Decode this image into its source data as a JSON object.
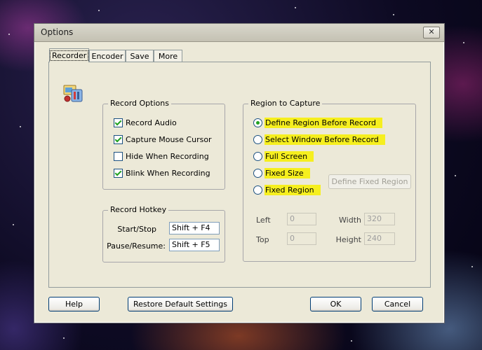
{
  "window": {
    "title": "Options",
    "close_glyph": "✕"
  },
  "tabs": [
    {
      "label": "Recorder",
      "active": true
    },
    {
      "label": "Encoder",
      "active": false
    },
    {
      "label": "Save",
      "active": false
    },
    {
      "label": "More",
      "active": false
    }
  ],
  "record_options": {
    "title": "Record Options",
    "items": [
      {
        "label": "Record Audio",
        "checked": true
      },
      {
        "label": "Capture Mouse Cursor",
        "checked": true
      },
      {
        "label": "Hide When Recording",
        "checked": false
      },
      {
        "label": "Blink When Recording",
        "checked": true
      }
    ]
  },
  "record_hotkey": {
    "title": "Record Hotkey",
    "start_stop_label": "Start/Stop",
    "start_stop_value": "Shift + F4",
    "pause_resume_label": "Pause/Resume:",
    "pause_resume_value": "Shift + F5"
  },
  "region": {
    "title": "Region to Capture",
    "options": [
      {
        "label": "Define Region Before Record",
        "selected": true
      },
      {
        "label": "Select Window Before Record",
        "selected": false
      },
      {
        "label": "Full Screen",
        "selected": false
      },
      {
        "label": "Fixed Size",
        "selected": false
      },
      {
        "label": "Fixed Region",
        "selected": false
      }
    ],
    "define_fixed_button": "Define Fixed Region",
    "left_label": "Left",
    "left_value": "0",
    "top_label": "Top",
    "top_value": "0",
    "width_label": "Width",
    "width_value": "320",
    "height_label": "Height",
    "height_value": "240"
  },
  "footer": {
    "help": "Help",
    "restore": "Restore Default Settings",
    "ok": "OK",
    "cancel": "Cancel"
  },
  "colors": {
    "highlight": "#f6ef1e",
    "check": "#21a121",
    "dialog_bg": "#ece9d8"
  },
  "icons": {
    "recorder": "recorder-app-icon"
  }
}
